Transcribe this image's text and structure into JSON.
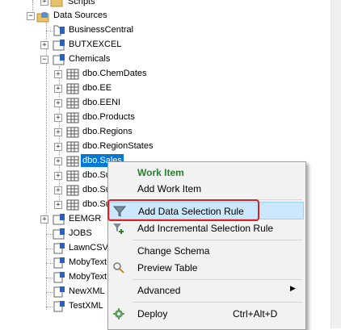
{
  "tree": {
    "scripts": "Scripts",
    "data_sources": "Data Sources",
    "business_central": "BusinessCentral",
    "butxexcel": "BUTXEXCEL",
    "chemicals": "Chemicals",
    "tables": [
      "dbo.ChemDates",
      "dbo.EE",
      "dbo.EENI",
      "dbo.Products",
      "dbo.Regions",
      "dbo.RegionStates",
      "dbo.Sales",
      "dbo.Su",
      "dbo.Su",
      "dbo.Su"
    ],
    "eemgr": "EEMGR",
    "jobs": "JOBS",
    "lawncsv": "LawnCSV",
    "mobytext1": "MobyText",
    "mobytext2": "MobyText",
    "newxml": "NewXML",
    "testxml": "TestXML"
  },
  "menu": {
    "header": "Work Item",
    "add_work_item": "Add Work Item",
    "add_data_selection_rule": "Add Data Selection Rule",
    "add_incremental_selection_rule": "Add Incremental Selection Rule",
    "change_schema": "Change Schema",
    "preview_table": "Preview Table",
    "advanced": "Advanced",
    "deploy": "Deploy",
    "deploy_shortcut": "Ctrl+Alt+D"
  },
  "colors": {
    "selection": "#0078d7",
    "menu_header": "#2e7d32",
    "hover": "#cce8ff",
    "highlight_box": "#e02020"
  }
}
